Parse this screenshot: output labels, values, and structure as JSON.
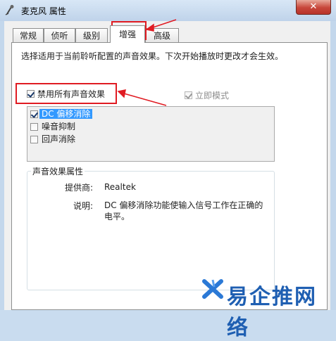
{
  "window": {
    "title": "麦克风 属性",
    "close_label": "✕"
  },
  "tabs": [
    {
      "label": "常规",
      "active": false
    },
    {
      "label": "侦听",
      "active": false
    },
    {
      "label": "级别",
      "active": false
    },
    {
      "label": "增强",
      "active": true
    },
    {
      "label": "高级",
      "active": false
    }
  ],
  "enhancements": {
    "description": "选择适用于当前聆听配置的声音效果。下次开始播放时更改才会生效。",
    "disable_all": {
      "label": "禁用所有声音效果",
      "checked": true
    },
    "immediate_mode": {
      "label": "立即模式",
      "checked": true,
      "disabled": true
    },
    "effects": [
      {
        "label": "DC 偏移消除",
        "checked": true,
        "selected": true
      },
      {
        "label": "噪音抑制",
        "checked": false,
        "selected": false
      },
      {
        "label": "回声消除",
        "checked": false,
        "selected": false
      }
    ],
    "properties": {
      "title": "声音效果属性",
      "provider_label": "提供商:",
      "provider_value": "Realtek",
      "description_label": "说明:",
      "description_value_line1": "DC 偏移消除功能使输入信号工作在正确的",
      "description_value_line2": "电平。"
    }
  },
  "watermark": {
    "text": "易企推网络"
  },
  "colors": {
    "annotation_red": "#e01b22",
    "selection_blue": "#3399ff",
    "watermark_blue": "#1f5fb2"
  }
}
